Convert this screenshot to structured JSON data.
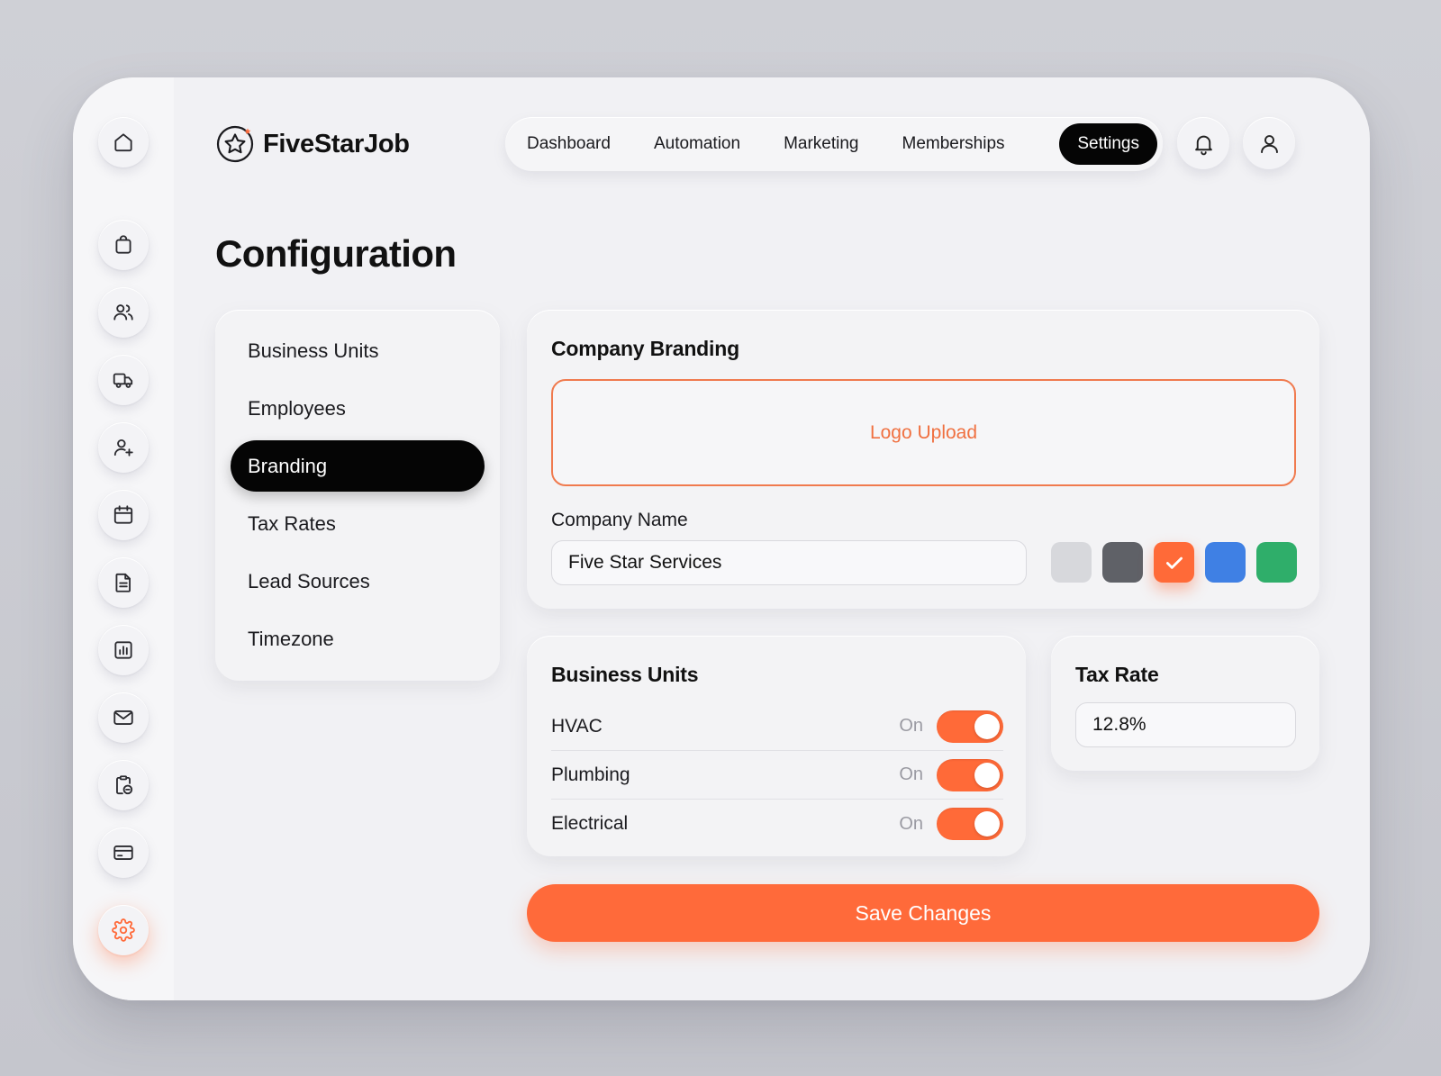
{
  "brand": {
    "name": "FiveStarJob",
    "accent": "#ff6a3a"
  },
  "rail": {
    "icons": [
      "home-icon",
      "shopping-bag-icon",
      "users-icon",
      "truck-icon",
      "user-plus-icon",
      "calendar-icon",
      "document-icon",
      "chart-icon",
      "mail-icon",
      "clipboard-icon",
      "credit-card-icon",
      "gear-icon"
    ],
    "active": "gear-icon"
  },
  "topnav": {
    "items": [
      "Dashboard",
      "Automation",
      "Marketing",
      "Memberships",
      "Settings"
    ],
    "active": "Settings"
  },
  "header_icons": [
    "bell-icon",
    "user-icon"
  ],
  "page": {
    "title": "Configuration"
  },
  "subnav": {
    "items": [
      "Business Units",
      "Employees",
      "Branding",
      "Tax Rates",
      "Lead Sources",
      "Timezone"
    ],
    "active": "Branding"
  },
  "branding": {
    "title": "Company Branding",
    "upload_label": "Logo Upload",
    "company_name_label": "Company Name",
    "company_name_value": "Five Star Services",
    "swatches": [
      {
        "color": "#d7d8dc",
        "selected": false
      },
      {
        "color": "#5f6167",
        "selected": false
      },
      {
        "color": "#ff6a38",
        "selected": true
      },
      {
        "color": "#3f80e4",
        "selected": false
      },
      {
        "color": "#2fae6a",
        "selected": false
      }
    ]
  },
  "business_units": {
    "title": "Business Units",
    "rows": [
      {
        "name": "HVAC",
        "state": "On"
      },
      {
        "name": "Plumbing",
        "state": "On"
      },
      {
        "name": "Electrical",
        "state": "On"
      }
    ]
  },
  "tax": {
    "title": "Tax Rate",
    "value": "12.8%"
  },
  "actions": {
    "save_label": "Save Changes"
  }
}
